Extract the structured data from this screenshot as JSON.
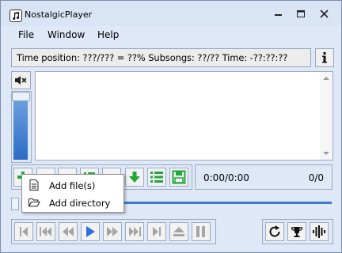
{
  "window": {
    "title": "NostalgicPlayer"
  },
  "menu": {
    "items": [
      "File",
      "Window",
      "Help"
    ]
  },
  "info": {
    "text": "Time position: ???/??? = ??% Subsongs: ??/?? Time: -??:??:??"
  },
  "time_display": {
    "time": "0:00/0:00",
    "count": "0/0"
  },
  "popup_menu": {
    "items": [
      {
        "label": "Add file(s)",
        "icon": "file-icon"
      },
      {
        "label": "Add directory",
        "icon": "folder-open-icon"
      }
    ]
  },
  "volume": {
    "level": 1.0
  },
  "colors": {
    "accent": "#3d7ad0",
    "green": "#22a53b"
  }
}
